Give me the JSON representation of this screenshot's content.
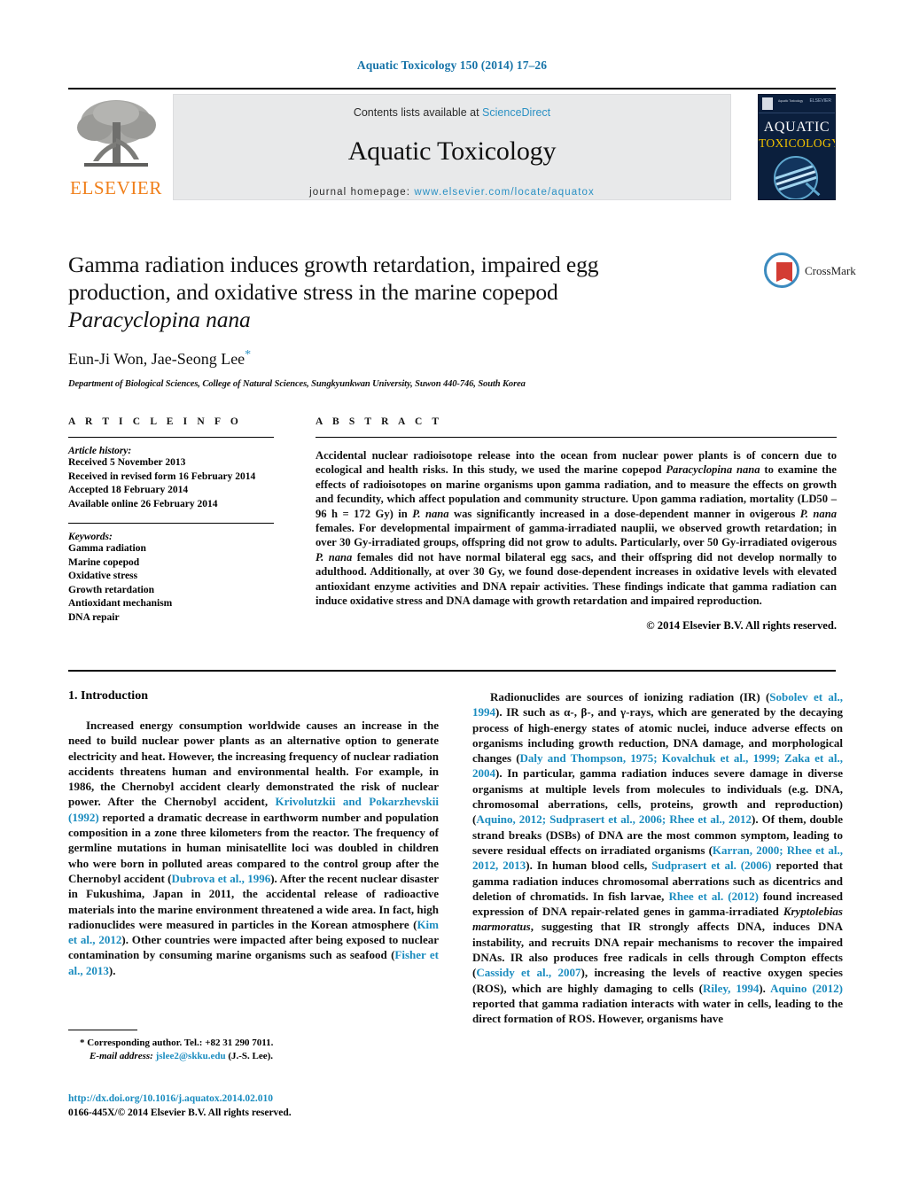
{
  "running_head": "Aquatic Toxicology 150 (2014) 17–26",
  "masthead": {
    "publisher_logo_text": "ELSEVIER",
    "publisher_logo_icon": "elsevier-tree-icon",
    "contents_prefix": "Contents lists available at",
    "contents_link": "ScienceDirect",
    "journal_name": "Aquatic Toxicology",
    "homepage_prefix": "journal homepage:",
    "homepage_url": "www.elsevier.com/locate/aquatox",
    "cover": {
      "title_line1": "AQUATIC",
      "title_line2": "TOXICOLOGY",
      "strip_label": "Aquatic Toxicology",
      "strip_right": "ELSEVIER"
    }
  },
  "crossmark": {
    "label": "CrossMark",
    "icon": "crossmark-icon"
  },
  "article": {
    "title_line1": "Gamma radiation induces growth retardation, impaired egg",
    "title_line2": "production, and oxidative stress in the marine copepod",
    "title_species": "Paracyclopina nana",
    "authors": "Eun-Ji Won, Jae-Seong Lee",
    "corresponding_marker": "*",
    "affiliation": "Department of Biological Sciences, College of Natural Sciences, Sungkyunkwan University, Suwon 440-746, South Korea"
  },
  "article_info": {
    "heading": "A R T I C L E   I N F O",
    "history_label": "Article history:",
    "history": [
      "Received 5 November 2013",
      "Received in revised form 16 February 2014",
      "Accepted 18 February 2014",
      "Available online 26 February 2014"
    ],
    "keywords_label": "Keywords:",
    "keywords": [
      "Gamma radiation",
      "Marine copepod",
      "Oxidative stress",
      "Growth retardation",
      "Antioxidant mechanism",
      "DNA repair"
    ]
  },
  "abstract": {
    "heading": "A B S T R A C T",
    "part1": "Accidental nuclear radioisotope release into the ocean from nuclear power plants is of concern due to ecological and health risks. In this study, we used the marine copepod ",
    "species1": "Paracyclopina nana",
    "part2": " to examine the effects of radioisotopes on marine organisms upon gamma radiation, and to measure the effects on growth and fecundity, which affect population and community structure. Upon gamma radiation, mortality (LD50 – 96 h = 172 Gy) in ",
    "species2": "P. nana",
    "part3": " was significantly increased in a dose-dependent manner in ovigerous ",
    "species3": "P. nana",
    "part4": " females. For developmental impairment of gamma-irradiated nauplii, we observed growth retardation; in over 30 Gy-irradiated groups, offspring did not grow to adults. Particularly, over 50 Gy-irradiated ovigerous ",
    "species4": "P. nana",
    "part5": " females did not have normal bilateral egg sacs, and their offspring did not develop normally to adulthood. Additionally, at over 30 Gy, we found dose-dependent increases in oxidative levels with elevated antioxidant enzyme activities and DNA repair activities. These findings indicate that gamma radiation can induce oxidative stress and DNA damage with growth retardation and impaired reproduction.",
    "copyright": "© 2014 Elsevier B.V. All rights reserved."
  },
  "body": {
    "section_title": "1.  Introduction",
    "left_p1_a": "Increased energy consumption worldwide causes an increase in the need to build nuclear power plants as an alternative option to generate electricity and heat. However, the increasing frequency of nuclear radiation accidents threatens human and environmental health. For example, in 1986, the Chernobyl accident clearly demonstrated the risk of nuclear power. After the Chernobyl accident, ",
    "cite_krivolutzkii": "Krivolutzkii and Pokarzhevskii (1992)",
    "left_p1_b": " reported a dramatic decrease in earthworm number and population composition in a zone three kilometers from the reactor. The frequency of germline mutations in human minisatellite loci was doubled in children who were born in polluted areas compared to the control group after the Chernobyl accident (",
    "cite_dubrova": "Dubrova et al., 1996",
    "left_p1_c": "). After the recent nuclear disaster in Fukushima, Japan in 2011, the accidental release of radioactive materials into the marine environment threatened a wide area. In fact, high radionuclides were measured in particles in the Korean atmosphere (",
    "cite_kim": "Kim et al., 2012",
    "left_p1_d": "). Other countries were impacted after being exposed to nuclear contamination by consuming marine organisms such as seafood (",
    "cite_fisher": "Fisher et al., 2013",
    "left_p1_e": ").",
    "right_p1_a": "Radionuclides are sources of ionizing radiation (IR) (",
    "cite_sobolev": "Sobolev et al., 1994",
    "right_p1_b": "). IR such as α-, β-, and γ-rays, which are generated by the decaying process of high-energy states of atomic nuclei, induce adverse effects on organisms including growth reduction, DNA damage, and morphological changes (",
    "cite_daly": "Daly and Thompson, 1975; Kovalchuk et al., 1999; Zaka et al., 2004",
    "right_p1_c": "). In particular, gamma radiation induces severe damage in diverse organisms at multiple levels from molecules to individuals (e.g. DNA, chromosomal aberrations, cells, proteins, growth and reproduction) (",
    "cite_aquino2012": "Aquino, 2012; Sudprasert et al., 2006; Rhee et al., 2012",
    "right_p1_d": "). Of them, double strand breaks (DSBs) of DNA are the most common symptom, leading to severe residual effects on irradiated organisms (",
    "cite_karran": "Karran, 2000; Rhee et al., 2012, 2013",
    "right_p1_e": "). In human blood cells, ",
    "cite_sudprasert": "Sudprasert et al. (2006)",
    "right_p1_f": " reported that gamma radiation induces chromosomal aberrations such as dicentrics and deletion of chromatids. In fish larvae, ",
    "cite_rhee": "Rhee et al. (2012)",
    "right_p1_g": " found increased expression of DNA repair-related genes in gamma-irradiated ",
    "species_krypto": "Kryptolebias marmoratus",
    "right_p1_h": ", suggesting that IR strongly affects DNA, induces DNA instability, and recruits DNA repair mechanisms to recover the impaired DNAs. IR also produces free radicals in cells through Compton effects (",
    "cite_cassidy": "Cassidy et al., 2007",
    "right_p1_i": "), increasing the levels of reactive oxygen species (ROS), which are highly damaging to cells (",
    "cite_riley": "Riley, 1994",
    "right_p1_j": "). ",
    "cite_aquino_2": "Aquino (2012)",
    "right_p1_k": " reported that gamma radiation interacts with water in cells, leading to the direct formation of ROS. However, organisms have"
  },
  "footnotes": {
    "star": "*",
    "corresponding": "Corresponding author. Tel.: +82 31 290 7011.",
    "email_label": "E-mail address:",
    "email": "jslee2@skku.edu",
    "email_suffix": "(J.-S. Lee).",
    "doi": "http://dx.doi.org/10.1016/j.aquatox.2014.02.010",
    "issn_line": "0166-445X/© 2014 Elsevier B.V. All rights reserved."
  },
  "colors": {
    "link_blue": "#1a8cbf",
    "header_blue": "#1673a8",
    "elsevier_orange": "#f07f1a",
    "band_gray": "#e8e9ea",
    "cover_navy": "#0b1f3d",
    "cover_yellow": "#f2c200"
  }
}
